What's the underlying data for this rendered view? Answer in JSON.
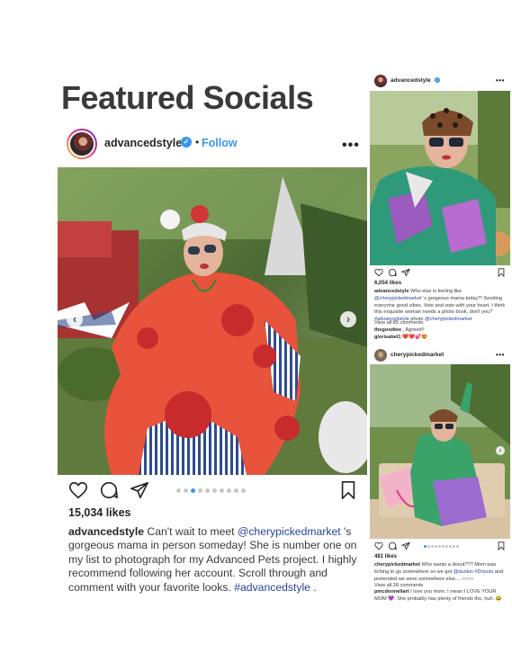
{
  "page": {
    "title": "Featured Socials"
  },
  "main_post": {
    "username": "advancedstyle",
    "follow_label": "Follow",
    "separator": "•",
    "more_label": "•••",
    "likes": "15,034 likes",
    "caption": {
      "username": "advancedstyle",
      "text_1": " Can't wait to meet ",
      "mention": "@cherypickedmarket",
      "text_2": " 's gorgeous mama in person someday! She is number one on my list to photograph for my Advanced Pets project. I highly recommend following her account. Scroll through and comment with your favorite looks. ",
      "hashtag": "#advancedstyle",
      "text_3": " ."
    },
    "carousel": {
      "count": 10,
      "active_index": 2
    },
    "prev_arrow": "‹",
    "next_arrow": "›"
  },
  "post_2": {
    "username": "advancedstyle",
    "more_label": "•••",
    "likes": "6,054 likes",
    "caption": {
      "username": "advancedstyle",
      "text_1": " Who else is feeling like ",
      "mention": "@cherypickedmarket",
      "text_2": " 's gorgeous mama today?! Sending everyone good vibes. Vote and vote with your heart. I think this exquisite woman needs a photo book, don't you? ",
      "hashtag": "#advancedstyle",
      "text_3": " photo ",
      "mention_2": "@cherypickedmarket"
    },
    "view_comments": "View all 85 comments",
    "comment_1": {
      "user": "thegoodtee_",
      "text": " Agreed!!"
    },
    "comment_2": {
      "user": "glorisabel1",
      "text": " ❤️❤️💕😍"
    }
  },
  "post_3": {
    "username": "cherypickedmarket",
    "more_label": "•••",
    "likes": "481 likes",
    "caption": {
      "username": "cherypickedmarket",
      "text_1": " Who wants a donut??? Mom was itching to go somewhere so we got ",
      "tag_1": "@dunkin",
      "hashtag": " #Donuts",
      "text_2": " and pretended we were somewhere else.... ",
      "more": "more"
    },
    "view_comments": "View all 28 comments",
    "comment_1": {
      "user": "pmcdonnellart",
      "text": " I love you mom. I mean I LOVE YOUR MOM 💜. She probably has plenty of friends tho, huh. 😂"
    },
    "carousel": {
      "count": 10,
      "active_index": 0
    },
    "next_arrow": "›"
  },
  "icons": {
    "verified": "verified-badge-icon",
    "heart": "heart-icon",
    "comment": "comment-icon",
    "share": "share-icon",
    "bookmark": "bookmark-icon"
  },
  "colors": {
    "link_blue": "#3897f0",
    "mention_blue": "#27439b",
    "title": "#3a3a3a"
  }
}
